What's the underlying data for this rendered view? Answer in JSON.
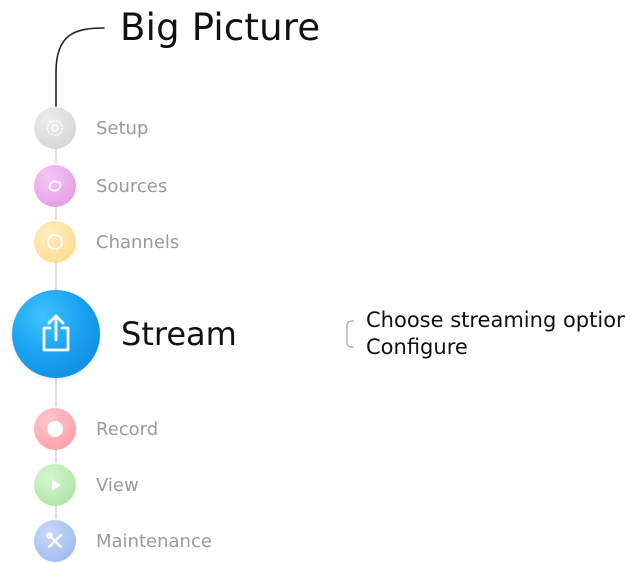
{
  "header": {
    "title": "Big Picture"
  },
  "menu": {
    "items": [
      {
        "label": "Setup",
        "icon": "gear-icon",
        "color": "#b9b9b9"
      },
      {
        "label": "Sources",
        "icon": "link-icon",
        "color": "#d25ad6"
      },
      {
        "label": "Channels",
        "icon": "circle-ring-icon",
        "color": "#ffc445"
      },
      {
        "label": "Stream",
        "icon": "share-upload-icon",
        "color": "#1aa3f0",
        "active": true
      },
      {
        "label": "Record",
        "icon": "record-icon",
        "color": "#ff5a6a"
      },
      {
        "label": "View",
        "icon": "play-icon",
        "color": "#7ad66a"
      },
      {
        "label": "Maintenance",
        "icon": "wrench-screwdriver-icon",
        "color": "#5b8de8"
      }
    ]
  },
  "stream_options": {
    "items": [
      "Choose streaming option",
      "Configure"
    ]
  }
}
